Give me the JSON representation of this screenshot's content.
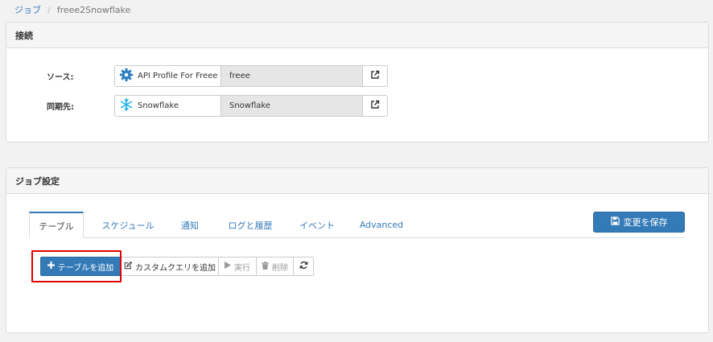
{
  "breadcrumb": {
    "parent": "ジョブ",
    "separator": "/",
    "current": "freee2Snowflake"
  },
  "connection_panel": {
    "title": "接続",
    "source": {
      "label": "ソース:",
      "name": "API Profile For Freee",
      "value": "freee"
    },
    "destination": {
      "label": "同期先:",
      "name": "Snowflake",
      "value": "Snowflake"
    }
  },
  "job_panel": {
    "title": "ジョブ設定",
    "tabs": [
      "テーブル",
      "スケジュール",
      "通知",
      "ログと履歴",
      "イベント",
      "Advanced"
    ],
    "save_label": "変更を保存",
    "toolbar": {
      "add_table": "テーブルを追加",
      "add_custom_query": "カスタムクエリを追加",
      "run": "実行",
      "delete": "削除"
    }
  },
  "colors": {
    "primary": "#337ab7",
    "highlight": "#e00000"
  }
}
